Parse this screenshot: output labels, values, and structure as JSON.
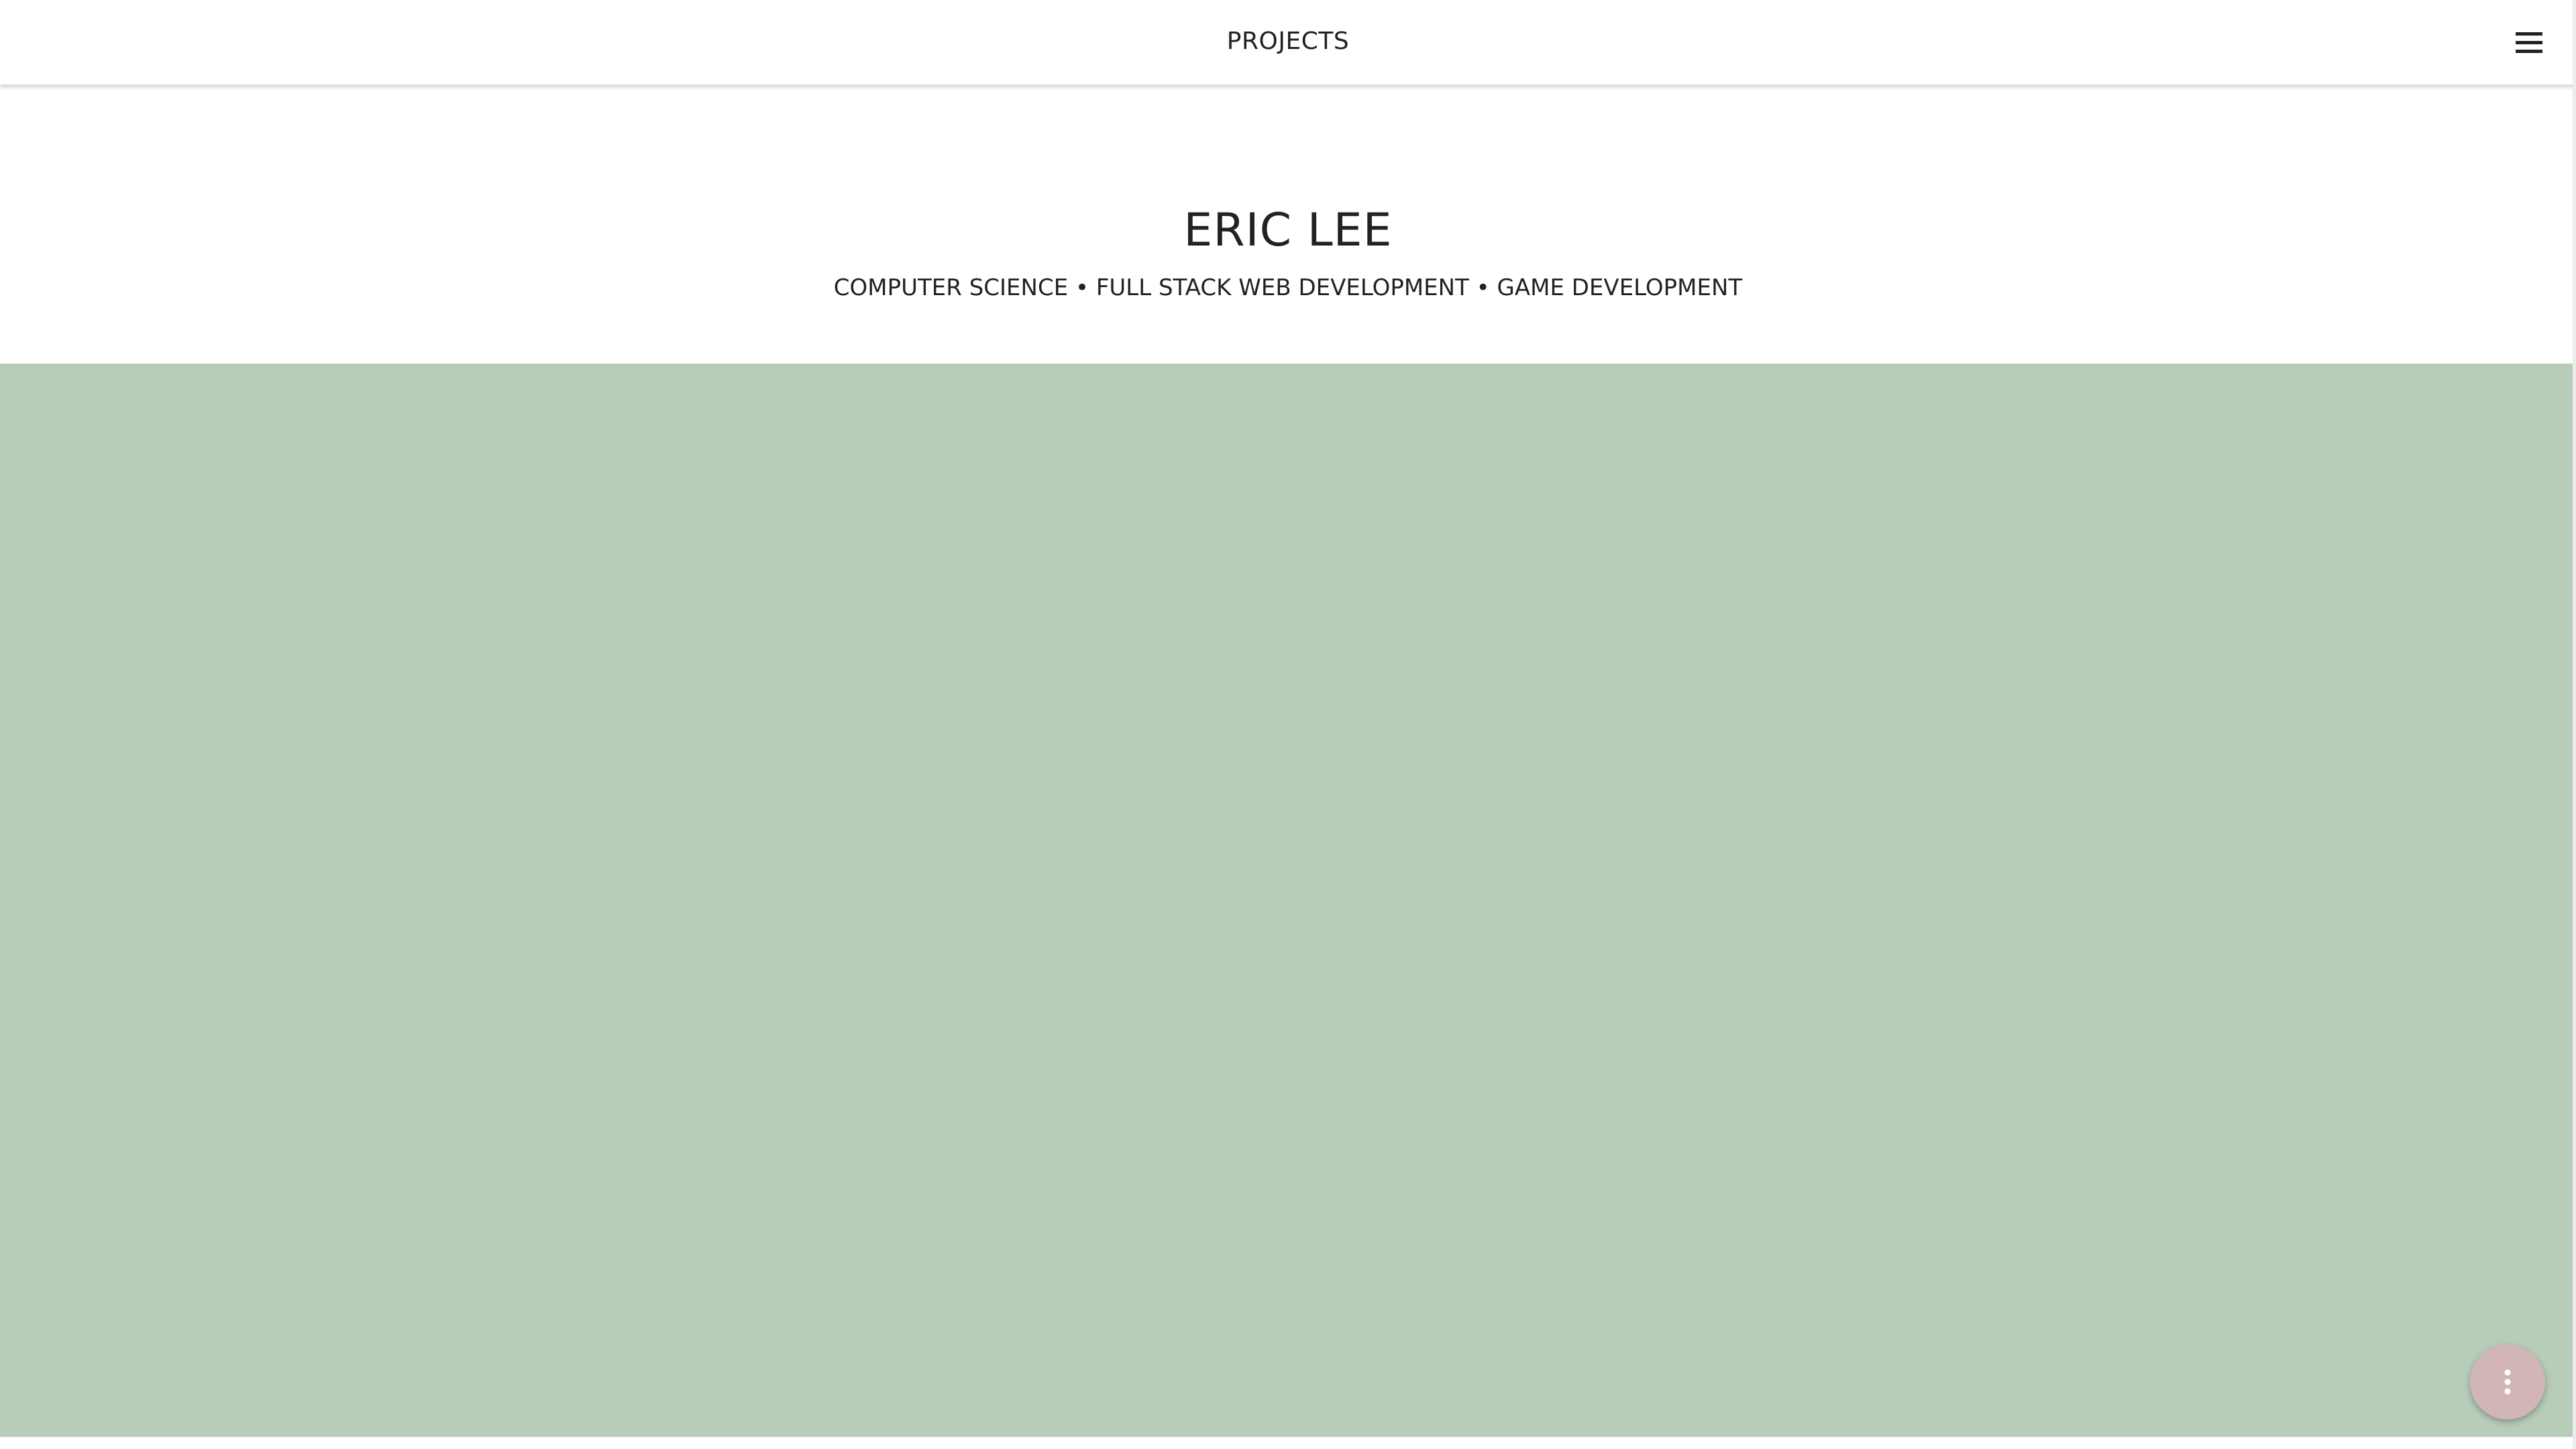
{
  "header": {
    "title": "PROJECTS",
    "menu_icon": "hamburger-menu-icon"
  },
  "hero": {
    "name": "ERIC LEE",
    "tagline": "COMPUTER SCIENCE • FULL STACK WEB DEVELOPMENT • GAME DEVELOPMENT"
  },
  "fab": {
    "icon": "more-vertical-icon"
  },
  "colors": {
    "header_background": "#ffffff",
    "text": "#222222",
    "panel_background": "#b7cdb9",
    "fab_background": "#d2b6b6"
  }
}
